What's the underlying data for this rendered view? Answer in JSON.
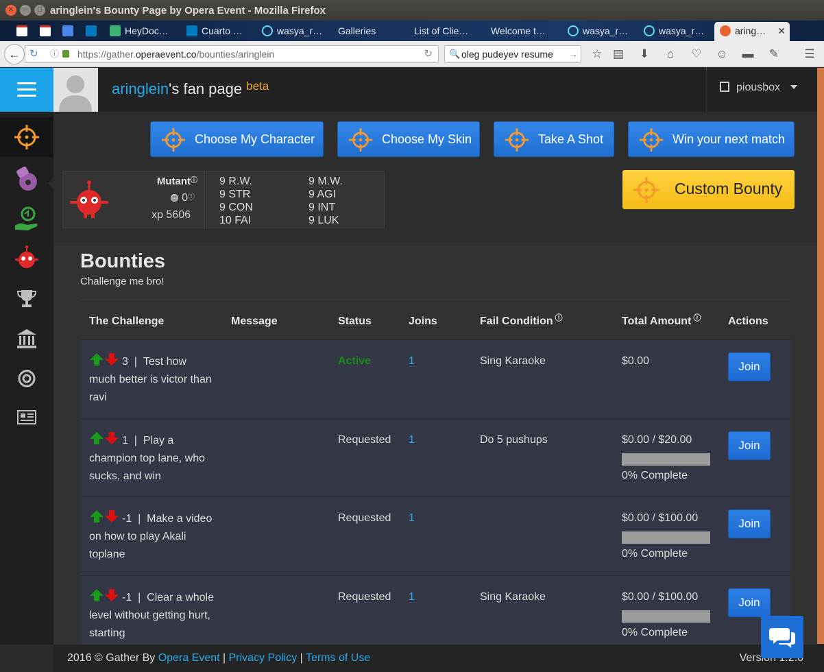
{
  "window": {
    "title": "aringlein's Bounty Page by Opera Event - Mozilla Firefox"
  },
  "tabs": [
    {
      "label": "",
      "icon": "gmail-icon"
    },
    {
      "label": "",
      "icon": "gmail-icon"
    },
    {
      "label": "",
      "icon": "translate-icon"
    },
    {
      "label": "",
      "icon": "trello-icon"
    },
    {
      "label": "HeyDoc…",
      "icon": "heydoctor-icon"
    },
    {
      "label": "Cuarto …",
      "icon": "trello-icon"
    },
    {
      "label": "wasya_r…",
      "icon": "react-icon"
    },
    {
      "label": "Galleries",
      "icon": ""
    },
    {
      "label": "List of Clie…",
      "icon": ""
    },
    {
      "label": "Welcome t…",
      "icon": ""
    },
    {
      "label": "wasya_r…",
      "icon": "react-icon"
    },
    {
      "label": "wasya_r…",
      "icon": "react-icon"
    },
    {
      "label": "aring…",
      "icon": "gather-icon",
      "active": true
    }
  ],
  "nav": {
    "url_prefix": "https://gather.",
    "url_domain": "operaevent.co",
    "url_path": "/bounties/aringlein",
    "search_value": "oleg pudeyev resume"
  },
  "header": {
    "username": "aringlein",
    "title_suffix": "'s fan page",
    "badge": "beta",
    "account_name": "piousbox"
  },
  "actions": {
    "choose_character": "Choose My Character",
    "choose_skin": "Choose My Skin",
    "take_shot": "Take A Shot",
    "win_match": "Win your next match",
    "custom_bounty": "Custom Bounty"
  },
  "character": {
    "name": "Mutant",
    "coins": "0",
    "xp": "xp 5606",
    "stats_left": [
      "9 R.W.",
      "9 STR",
      "9 CON",
      "10 FAI"
    ],
    "stats_right": [
      "9 M.W.",
      "9 AGI",
      "9 INT",
      "9 LUK"
    ]
  },
  "bounties": {
    "title": "Bounties",
    "subtitle": "Challenge me bro!",
    "columns": {
      "challenge": "The Challenge",
      "message": "Message",
      "status": "Status",
      "joins": "Joins",
      "fail": "Fail Condition",
      "amount": "Total Amount",
      "actions": "Actions"
    },
    "rows": [
      {
        "votes": "3",
        "challenge": "Test how much better is victor than ravi",
        "status": "Active",
        "joins": "1",
        "fail": "Sing Karaoke",
        "amount": "$0.00",
        "progress": 0,
        "complete": "",
        "join": "Join"
      },
      {
        "votes": "1",
        "challenge": "Play a champion top lane, who sucks, and win",
        "status": "Requested",
        "joins": "1",
        "fail": "Do 5 pushups",
        "amount": "$0.00 / $20.00",
        "progress": 0,
        "complete": "0% Complete",
        "join": "Join"
      },
      {
        "votes": "-1",
        "challenge": "Make a video on how to play Akali toplane",
        "status": "Requested",
        "joins": "1",
        "fail": "",
        "amount": "$0.00 / $100.00",
        "progress": 0,
        "complete": "0% Complete",
        "join": "Join"
      },
      {
        "votes": "-1",
        "challenge": "Clear a whole level without getting hurt, starting",
        "status": "Requested",
        "joins": "1",
        "fail": "Sing Karaoke",
        "amount": "$0.00 / $100.00",
        "progress": 0,
        "complete": "0% Complete",
        "join": "Join"
      }
    ]
  },
  "footer": {
    "copyright": "2016 © Gather By ",
    "brand": "Opera Event",
    "privacy": "Privacy Policy",
    "terms": "Terms of Use",
    "separator": " | ",
    "version": "Version 1.2.0"
  },
  "colors": {
    "accent_blue": "#1aa3e8",
    "button_blue": "#1f6fd0",
    "custom_yellow": "#f5bc15",
    "active_green": "#1d8a1d",
    "vote_up": "#1a9a1a",
    "vote_down": "#e01010",
    "target_orange": "#f39a2b"
  }
}
